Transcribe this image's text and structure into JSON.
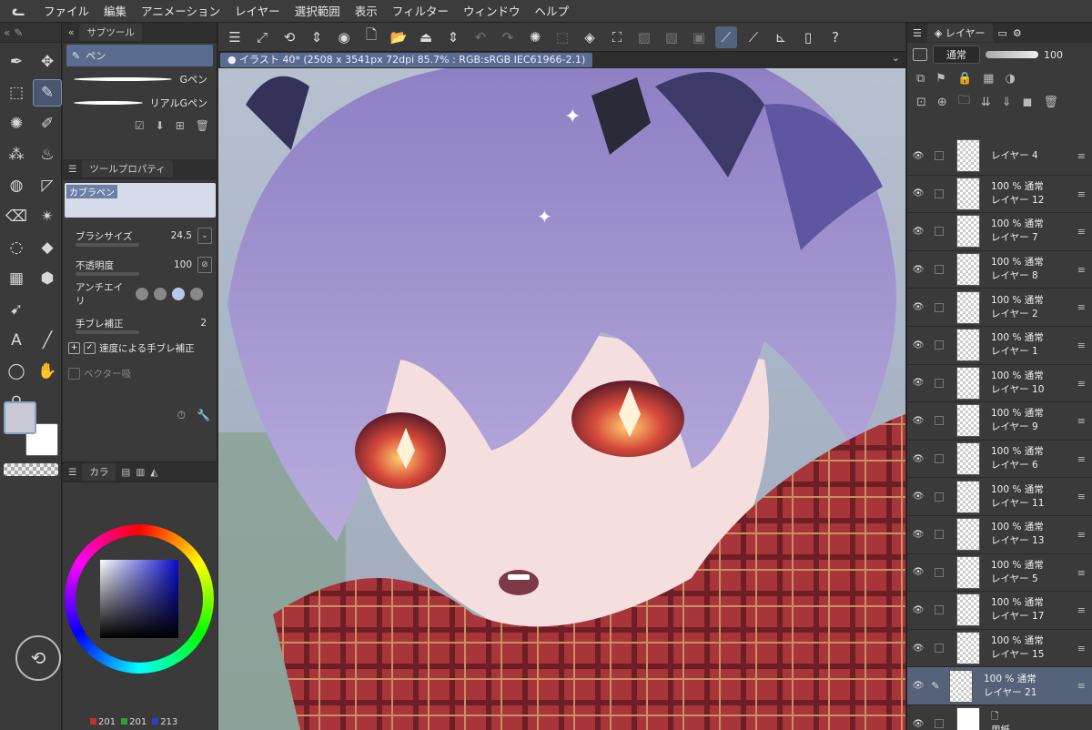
{
  "menu": [
    "ファイル",
    "編集",
    "アニメーション",
    "レイヤー",
    "選択範囲",
    "表示",
    "フィルター",
    "ウィンドウ",
    "ヘルプ"
  ],
  "subtool": {
    "tab": "サブツール",
    "items": [
      {
        "label": "ペン",
        "active": true
      },
      {
        "label": "Gペン",
        "active": false
      },
      {
        "label": "リアルGペン",
        "active": false
      }
    ]
  },
  "tool_property": {
    "tab": "ツールプロパティ",
    "brush_name": "カブラペン",
    "brush_size_label": "ブラシサイズ",
    "brush_size": "24.5",
    "opacity_label": "不透明度",
    "opacity": "100",
    "antialias_label": "アンチエイリ",
    "stabilization_label": "手ブレ補正",
    "stabilization": "2",
    "speed_stabilization_label": "速度による手ブレ補正",
    "vector_label": "ベクター吸"
  },
  "color": {
    "tab": "カラ",
    "r": "201",
    "g": "201",
    "b": "213",
    "main_color": "#c9c9d5"
  },
  "document": {
    "title": "イラスト 40* (2508 x 3541px 72dpi 85.7% : RGB:sRGB IEC61966-2.1)"
  },
  "layer_panel": {
    "tab": "レイヤー",
    "blend_mode": "通常",
    "opacity": "100",
    "layers": [
      {
        "name": "レイヤー 4",
        "mode": "",
        "selected": false
      },
      {
        "name": "レイヤー 12",
        "mode": "100 % 通常",
        "selected": false
      },
      {
        "name": "レイヤー 7",
        "mode": "100 % 通常",
        "selected": false
      },
      {
        "name": "レイヤー 8",
        "mode": "100 % 通常",
        "selected": false
      },
      {
        "name": "レイヤー 2",
        "mode": "100 % 通常",
        "selected": false
      },
      {
        "name": "レイヤー 1",
        "mode": "100 % 通常",
        "selected": false
      },
      {
        "name": "レイヤー 10",
        "mode": "100 % 通常",
        "selected": false
      },
      {
        "name": "レイヤー 9",
        "mode": "100 % 通常",
        "selected": false
      },
      {
        "name": "レイヤー 6",
        "mode": "100 % 通常",
        "selected": false
      },
      {
        "name": "レイヤー 11",
        "mode": "100 % 通常",
        "selected": false
      },
      {
        "name": "レイヤー 13",
        "mode": "100 % 通常",
        "selected": false
      },
      {
        "name": "レイヤー 5",
        "mode": "100 % 通常",
        "selected": false
      },
      {
        "name": "レイヤー 17",
        "mode": "100 % 通常",
        "selected": false
      },
      {
        "name": "レイヤー 15",
        "mode": "100 % 通常",
        "selected": false
      },
      {
        "name": "レイヤー 21",
        "mode": "100 % 通常",
        "selected": true
      },
      {
        "name": "用紙",
        "mode": "",
        "selected": false
      }
    ]
  }
}
